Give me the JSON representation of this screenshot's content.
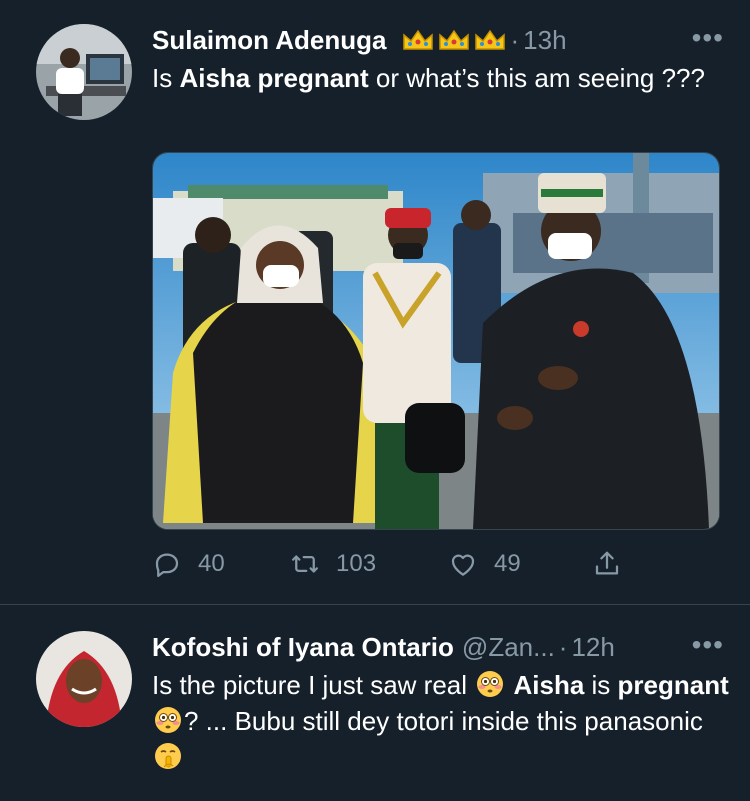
{
  "tweets": [
    {
      "author_name": "Sulaimon Adenuga",
      "badge": [
        "crown-emoji",
        "crown-emoji",
        "crown-emoji"
      ],
      "separator": "·",
      "time": "13h",
      "more": "•••",
      "text_parts": {
        "p1": "Is ",
        "b1": "Aisha pregnant",
        "p2": " or what’s this am seeing ???"
      },
      "stats": {
        "replies": "40",
        "retweets": "103",
        "likes": "49"
      }
    },
    {
      "author_name": "Kofoshi of Iyana Ontario",
      "handle": "@Zan...",
      "separator": "·",
      "time": "12h",
      "more": "•••",
      "text_parts": {
        "p1": "Is the picture I just saw real ",
        "b1": "Aisha",
        "p2": " is ",
        "b2": "pregnant",
        "p3": "? ... Bubu still dey totori inside this panasonic "
      }
    }
  ],
  "colors": {
    "background": "#15202b",
    "muted": "#8899a6",
    "divider": "#38444d"
  },
  "icons": [
    "reply-icon",
    "retweet-icon",
    "like-icon",
    "share-icon",
    "flushed-face-emoji",
    "shushing-face-emoji"
  ]
}
